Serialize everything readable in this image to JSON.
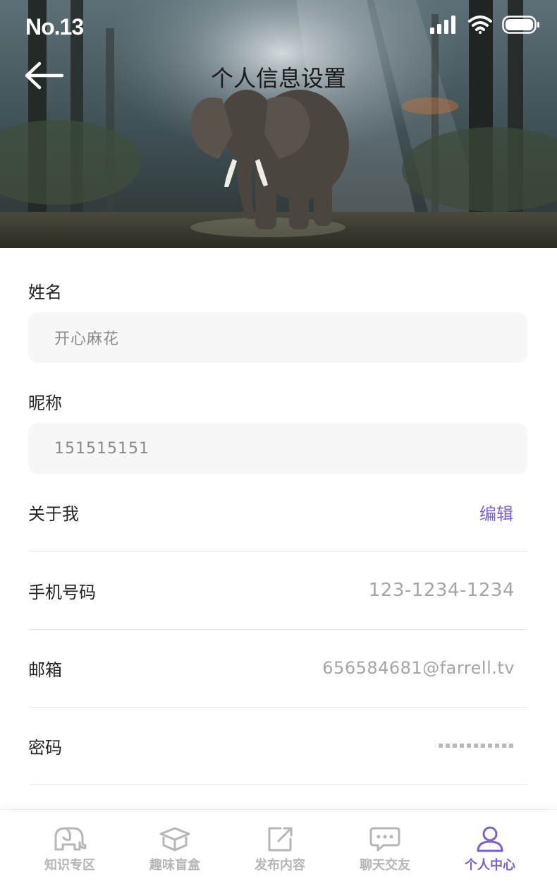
{
  "status_bar": {
    "time": "No.13"
  },
  "header": {
    "title": "个人信息设置"
  },
  "form": {
    "name_label": "姓名",
    "name_value": "开心麻花",
    "nickname_label": "昵称",
    "nickname_value": "151515151"
  },
  "rows": {
    "about_label": "关于我",
    "about_action": "编辑",
    "phone_label": "手机号码",
    "phone_value": "123-1234-1234",
    "email_label": "邮箱",
    "email_value": "656584681@farrell.tv",
    "password_label": "密码"
  },
  "tabbar": {
    "items": [
      {
        "label": "知识专区",
        "icon": "elephant-icon"
      },
      {
        "label": "趣味盲盒",
        "icon": "box-icon"
      },
      {
        "label": "发布内容",
        "icon": "share-icon"
      },
      {
        "label": "聊天交友",
        "icon": "chat-icon"
      },
      {
        "label": "个人中心",
        "icon": "user-icon",
        "active": true
      }
    ]
  },
  "colors": {
    "accent": "#7b62d0",
    "field_bg": "#f7f7f8",
    "muted_text": "#a5a5a5"
  }
}
